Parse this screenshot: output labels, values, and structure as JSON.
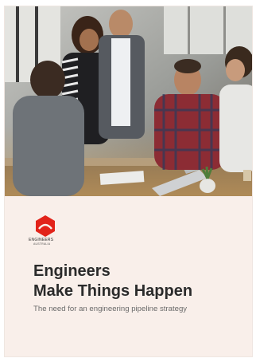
{
  "cover": {
    "logo": {
      "name_line1": "ENGINEERS",
      "name_line2": "AUSTRALIA"
    },
    "title_line1": "Engineers",
    "title_line2": "Make Things Happen",
    "subtitle": "The need for an engineering pipeline strategy"
  },
  "colors": {
    "background": "#f9efea",
    "logo_red": "#e2231a",
    "title": "#2b2b2b",
    "subtitle": "#6a6a6a"
  },
  "icons": [
    "engineers-australia-logo-icon"
  ]
}
